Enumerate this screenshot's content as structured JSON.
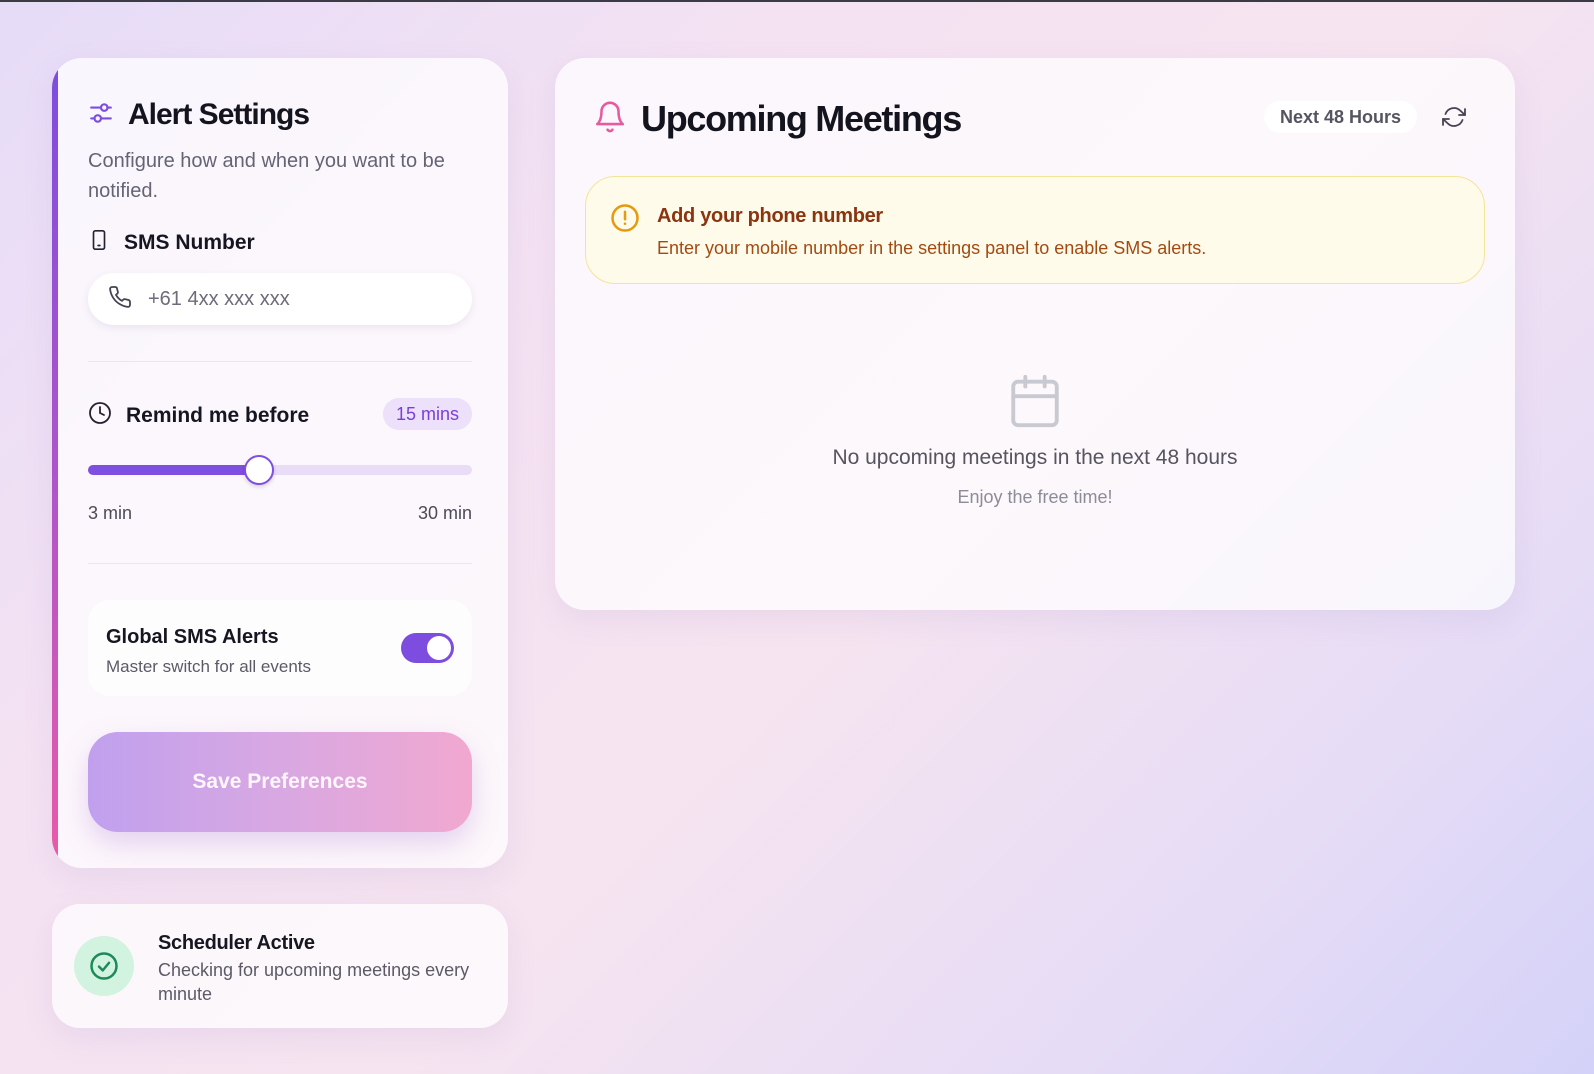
{
  "settings": {
    "title": "Alert Settings",
    "description": "Configure how and when you want to be notified.",
    "sms_label": "SMS Number",
    "phone_placeholder": "+61 4xx xxx xxx",
    "remind_label": "Remind me before",
    "remind_badge": "15 mins",
    "slider": {
      "min": 3,
      "max": 30,
      "value": 15,
      "min_label": "3 min",
      "max_label": "30 min"
    },
    "global_title": "Global SMS Alerts",
    "global_desc": "Master switch for all events",
    "global_enabled": true,
    "save_label": "Save Preferences"
  },
  "scheduler": {
    "title": "Scheduler Active",
    "description": "Checking for upcoming meetings every minute"
  },
  "meetings": {
    "title": "Upcoming Meetings",
    "range_label": "Next 48 Hours",
    "warning_title": "Add your phone number",
    "warning_text": "Enter your mobile number in the settings panel to enable SMS alerts.",
    "empty_title": "No upcoming meetings in the next 48 hours",
    "empty_sub": "Enjoy the free time!"
  },
  "colors": {
    "accent_purple": "#7c4ddf",
    "accent_pink": "#ea5aa8",
    "warning_text": "#8a3410",
    "success": "#1d8a5a"
  },
  "icons": [
    "sliders-icon",
    "smartphone-icon",
    "phone-icon",
    "clock-icon",
    "check-circle-icon",
    "bell-icon",
    "refresh-icon",
    "alert-circle-icon",
    "calendar-icon"
  ]
}
